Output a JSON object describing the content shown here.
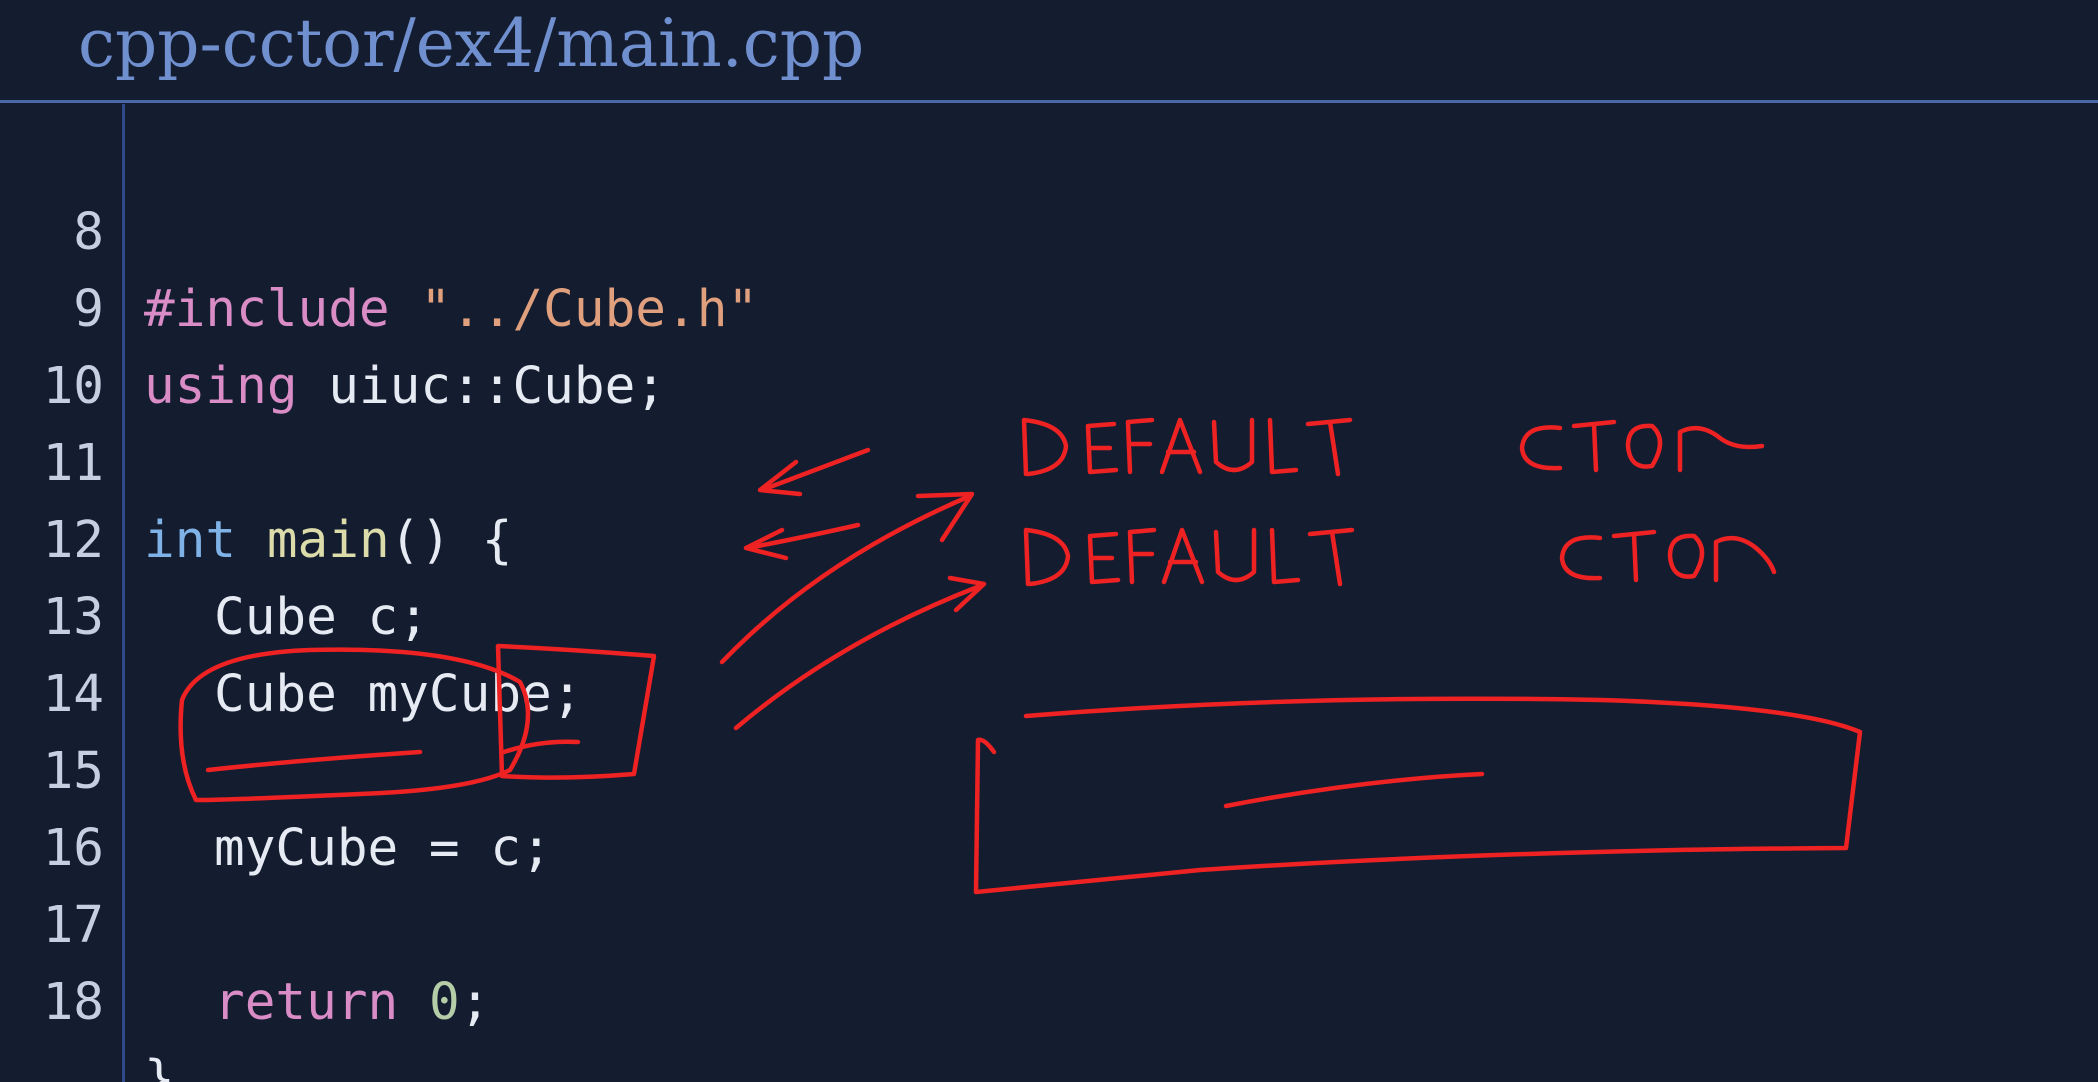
{
  "header": {
    "file_path": "cpp-cctor/ex4/main.cpp"
  },
  "code": {
    "lines": [
      {
        "number": "8",
        "tokens": [
          "#include",
          " ",
          "\"../Cube.h\""
        ]
      },
      {
        "number": "9",
        "tokens": [
          "using",
          " uiuc::Cube;"
        ]
      },
      {
        "number": "10",
        "tokens": []
      },
      {
        "number": "11",
        "tokens": [
          "int",
          " ",
          "main",
          "() {"
        ]
      },
      {
        "number": "12",
        "tokens": [
          "Cube c;"
        ]
      },
      {
        "number": "13",
        "tokens": [
          "Cube myCube;"
        ]
      },
      {
        "number": "14",
        "tokens": []
      },
      {
        "number": "15",
        "tokens": [
          "myCube = c;"
        ]
      },
      {
        "number": "16",
        "tokens": []
      },
      {
        "number": "17",
        "tokens": [
          "return",
          " ",
          "0",
          ";"
        ]
      },
      {
        "number": "18",
        "tokens": [
          "}"
        ]
      }
    ]
  },
  "annotations": {
    "handwriting": [
      "DEFAULT CTOR",
      "DEFAULT CTOR"
    ],
    "ink_color": "#ee2222"
  },
  "colors": {
    "background": "#141c30",
    "title": "#6f8fce",
    "rule": "#4a67a8",
    "preprocessor": "#d98cc6",
    "string": "#e0a07e",
    "type": "#7fb2e6",
    "function": "#dcdcaa",
    "number": "#b5cea8"
  }
}
